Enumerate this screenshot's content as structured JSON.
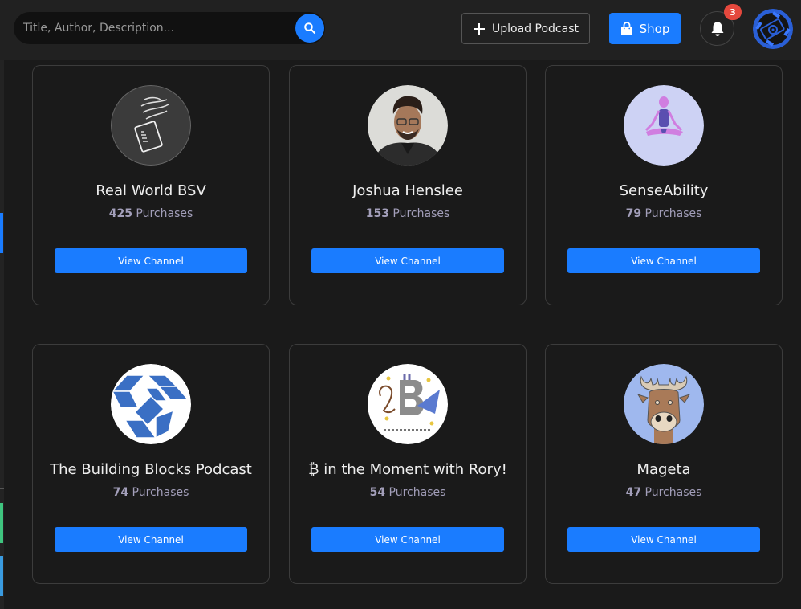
{
  "header": {
    "search_placeholder": "Title, Author, Description...",
    "search_icon": "search-icon",
    "upload_label": "Upload Podcast",
    "upload_icon": "plus-icon",
    "shop_label": "Shop",
    "shop_icon": "shopping-bag-icon",
    "notifications_icon": "bell-icon",
    "notification_count": "3",
    "user_avatar_icon": "user-avatar"
  },
  "colors": {
    "accent": "#1a7cff",
    "badge": "#e5483d",
    "sidebar_marks": [
      "#1a7cff",
      "#3fc47f",
      "#3a9be0"
    ]
  },
  "channels": [
    {
      "name": "Real World BSV",
      "purchases": "425",
      "purchases_label": "Purchases",
      "button": "View Channel",
      "avatar": "winged-hand-card-logo"
    },
    {
      "name": "Joshua Henslee",
      "purchases": "153",
      "purchases_label": "Purchases",
      "button": "View Channel",
      "avatar": "person-portrait"
    },
    {
      "name": "SenseAbility",
      "purchases": "79",
      "purchases_label": "Purchases",
      "button": "View Channel",
      "avatar": "meditating-skeleton"
    },
    {
      "name": "The Building Blocks Podcast",
      "purchases": "74",
      "purchases_label": "Purchases",
      "button": "View Channel",
      "avatar": "blue-blocks-logo"
    },
    {
      "name": "₿ in the Moment with Rory!",
      "purchases": "54",
      "purchases_label": "Purchases",
      "button": "View Channel",
      "avatar": "bee-in-the-moment-logo"
    },
    {
      "name": "Mageta",
      "purchases": "47",
      "purchases_label": "Purchases",
      "button": "View Channel",
      "avatar": "moose-cartoon"
    }
  ]
}
